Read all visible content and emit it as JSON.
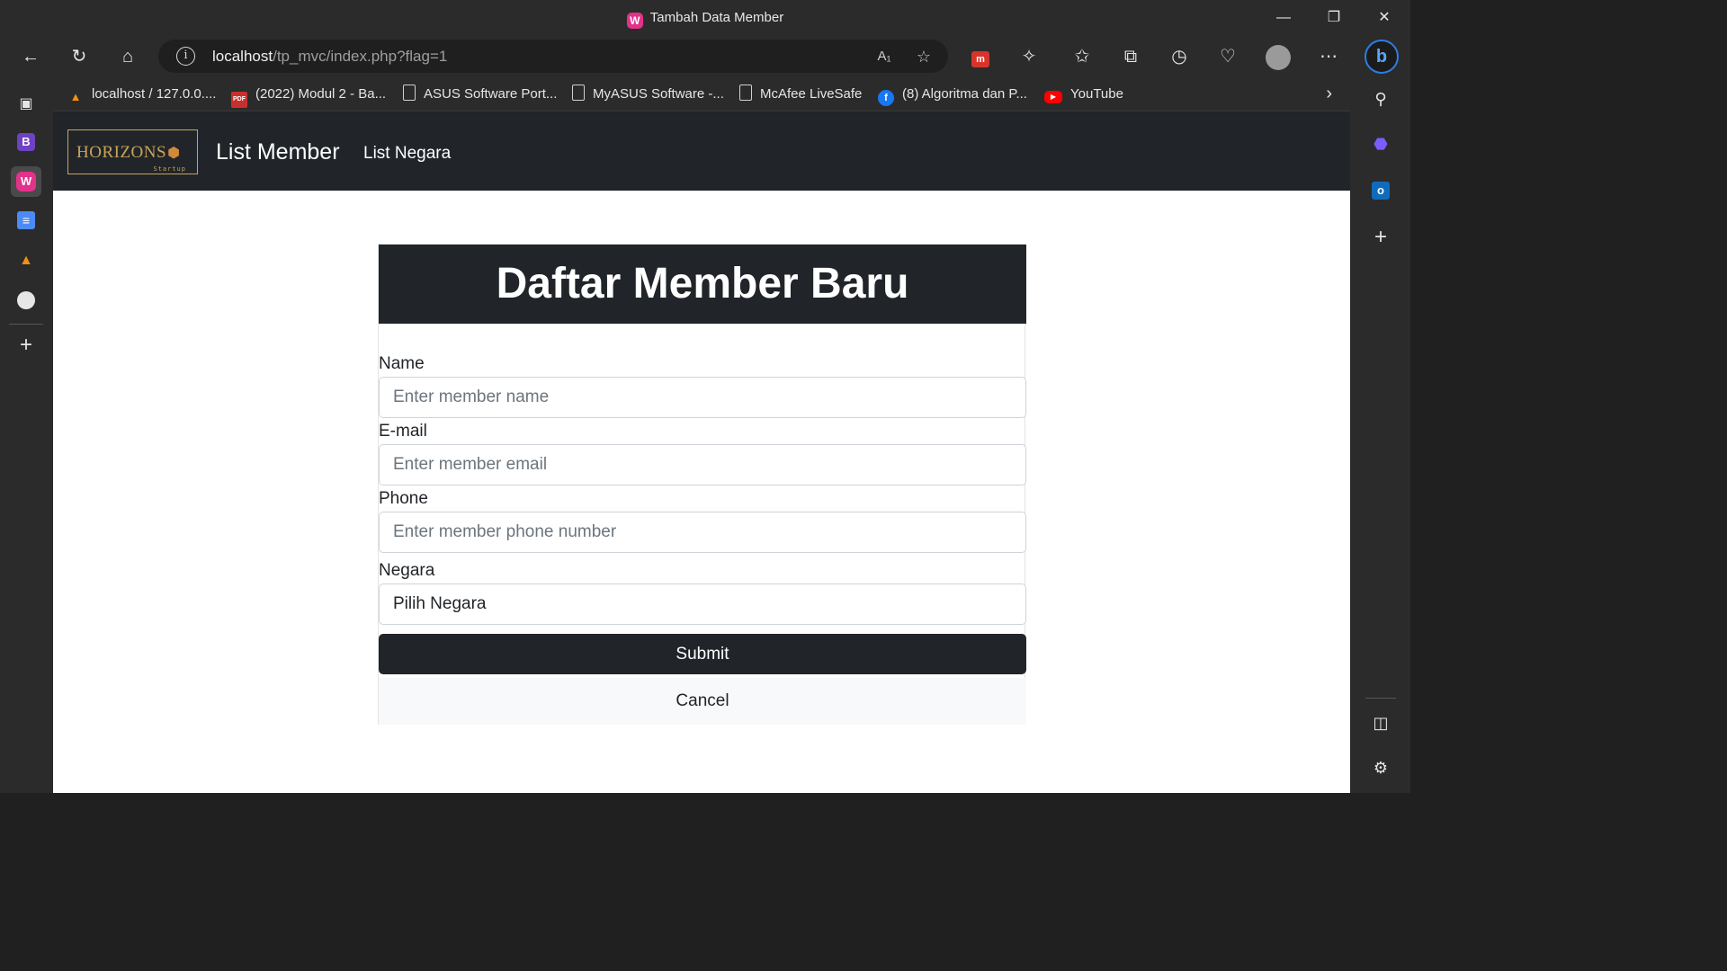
{
  "window": {
    "title": "Tambah Data Member",
    "favicon_icon": "wamp-icon"
  },
  "toolbar": {
    "url_host": "localhost",
    "url_path": "/tp_mvc/index.php?flag=1"
  },
  "bookmarks": [
    {
      "label": "localhost / 127.0.0....",
      "icon": "phpmyadmin-icon"
    },
    {
      "label": "(2022) Modul 2 - Ba...",
      "icon": "pdf-icon"
    },
    {
      "label": "ASUS Software Port...",
      "icon": "document-icon"
    },
    {
      "label": "MyASUS Software -...",
      "icon": "document-icon"
    },
    {
      "label": "McAfee LiveSafe",
      "icon": "document-icon"
    },
    {
      "label": "(8) Algoritma dan P...",
      "icon": "facebook-icon"
    },
    {
      "label": "YouTube",
      "icon": "youtube-icon"
    }
  ],
  "sidebar_left": {
    "b_letter": "B"
  },
  "navbar": {
    "logo_text": "HORIZONS",
    "logo_tagline": "Startup",
    "brand": "List Member",
    "link": "List Negara"
  },
  "form": {
    "heading": "Daftar Member Baru",
    "name_label": "Name",
    "name_placeholder": "Enter member name",
    "email_label": "E-mail",
    "email_placeholder": "Enter member email",
    "phone_label": "Phone",
    "phone_placeholder": "Enter member phone number",
    "country_label": "Negara",
    "country_selected": "Pilih Negara",
    "submit_label": "Submit",
    "cancel_label": "Cancel"
  }
}
